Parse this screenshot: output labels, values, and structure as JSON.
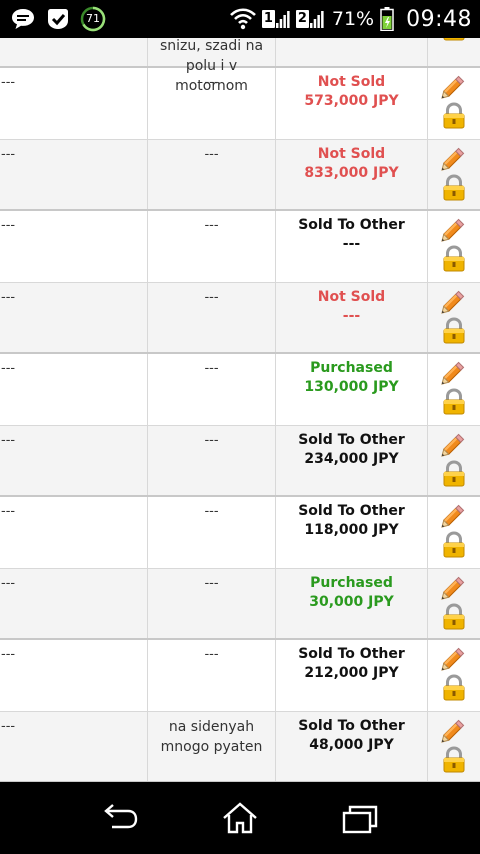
{
  "status_bar": {
    "notification_badge": "71",
    "sim1": "1",
    "sim2": "2",
    "battery": "71%",
    "time": "09:48"
  },
  "top_row": {
    "note": "snizu, szadi na polu i v motornom"
  },
  "rows": [
    {
      "col1": "---",
      "col2": "---",
      "status": "Not Sold",
      "price": "573,000 JPY",
      "tone": "red"
    },
    {
      "col1": "---",
      "col2": "---",
      "status": "Not Sold",
      "price": "833,000 JPY",
      "tone": "red"
    },
    {
      "col1": "---",
      "col2": "---",
      "status": "Sold To Other",
      "price": "---",
      "tone": "black"
    },
    {
      "col1": "---",
      "col2": "---",
      "status": "Not Sold",
      "price": "---",
      "tone": "red"
    },
    {
      "col1": "---",
      "col2": "---",
      "status": "Purchased",
      "price": "130,000 JPY",
      "tone": "green"
    },
    {
      "col1": "---",
      "col2": "---",
      "status": "Sold To Other",
      "price": "234,000 JPY",
      "tone": "black"
    },
    {
      "col1": "---",
      "col2": "---",
      "status": "Sold To Other",
      "price": "118,000 JPY",
      "tone": "black"
    },
    {
      "col1": "---",
      "col2": "---",
      "status": "Purchased",
      "price": "30,000 JPY",
      "tone": "green"
    },
    {
      "col1": "---",
      "col2": "---",
      "status": "Sold To Other",
      "price": "212,000 JPY",
      "tone": "black"
    },
    {
      "col1": "---",
      "col2": "na sidenyah mnogo pyaten",
      "status": "Sold To Other",
      "price": "48,000 JPY",
      "tone": "black"
    }
  ],
  "colors": {
    "not_sold": "#e05050",
    "purchased": "#2a9a1e",
    "sold_to_other": "#111111"
  },
  "icons": {
    "row_actions": [
      "pencil-icon",
      "lock-icon"
    ],
    "nav": [
      "back-icon",
      "home-icon",
      "recent-apps-icon"
    ]
  }
}
